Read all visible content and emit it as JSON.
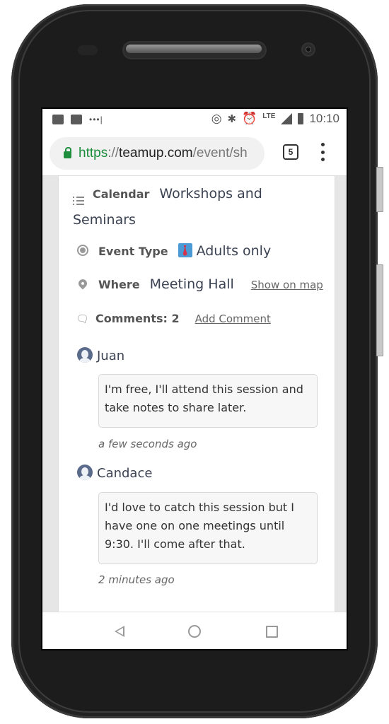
{
  "statusbar": {
    "left_icons": [
      "image-icon",
      "activity-icon",
      "more-notifications-icon"
    ],
    "right_icons": [
      "hotspot-icon",
      "bluetooth-icon",
      "alarm-icon",
      "signal-icon",
      "battery-icon"
    ],
    "network": "LTE",
    "time": "10:10"
  },
  "browser": {
    "url_scheme": "https",
    "url_separator": "://",
    "url_host": "teamup.com",
    "url_path": "/event/sh",
    "tab_count": "5"
  },
  "event": {
    "calendar_label": "Calendar",
    "calendar_value_line1": "Workshops and",
    "calendar_value_line2": "Seminars",
    "event_type_label": "Event Type",
    "event_type_value": "Adults only",
    "where_label": "Where",
    "where_value": "Meeting Hall",
    "show_on_map": "Show on map",
    "comments_label": "Comments: 2",
    "add_comment": "Add Comment"
  },
  "comments": [
    {
      "author": "Juan",
      "text": "I'm free, I'll attend this session and take notes to share later.",
      "time": "a few seconds ago"
    },
    {
      "author": "Candace",
      "text": "I'd love to catch this session but I have one on one meetings until 9:30. I'll come after that.",
      "time": "2 minutes ago"
    }
  ],
  "navbar": {
    "buttons": [
      "back",
      "home",
      "recents"
    ]
  }
}
